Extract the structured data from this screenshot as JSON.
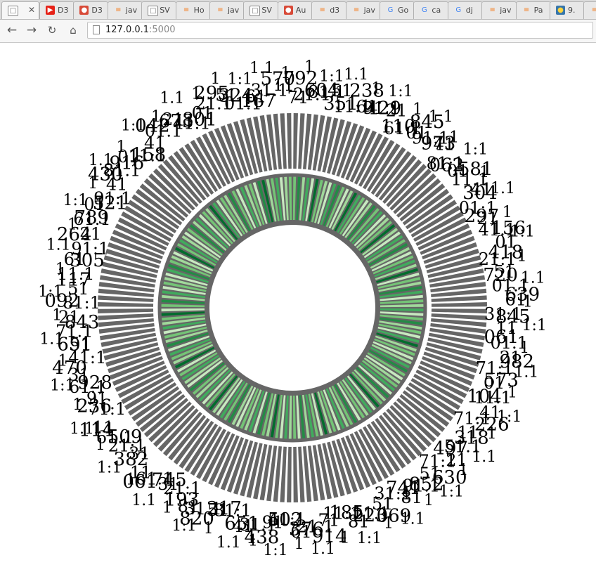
{
  "browser": {
    "tabs": [
      {
        "title": "",
        "icon": "page-icon",
        "active": true
      },
      {
        "title": "D3",
        "icon": "youtube-icon"
      },
      {
        "title": "D3",
        "icon": "chrome-app-icon"
      },
      {
        "title": "jav",
        "icon": "stackoverflow-icon"
      },
      {
        "title": "SV",
        "icon": "page-icon"
      },
      {
        "title": "Ho",
        "icon": "stackoverflow-icon"
      },
      {
        "title": "jav",
        "icon": "stackoverflow-icon"
      },
      {
        "title": "SV",
        "icon": "page-icon"
      },
      {
        "title": "Au",
        "icon": "chrome-app-icon"
      },
      {
        "title": "d3",
        "icon": "stackoverflow-icon"
      },
      {
        "title": "jav",
        "icon": "stackoverflow-icon"
      },
      {
        "title": "Go",
        "icon": "google-icon"
      },
      {
        "title": "ca",
        "icon": "google-icon"
      },
      {
        "title": "dj",
        "icon": "google-icon"
      },
      {
        "title": "jav",
        "icon": "stackoverflow-icon"
      },
      {
        "title": "Pa",
        "icon": "stackoverflow-icon"
      },
      {
        "title": "9.",
        "icon": "python-icon"
      },
      {
        "title": "",
        "icon": "stackoverflow-icon"
      }
    ],
    "url_host": "127.0.0.1",
    "url_port": ":5000",
    "nav_icons": [
      "back-arrow-icon",
      "forward-arrow-icon",
      "reload-icon",
      "home-icon"
    ]
  },
  "colors": {
    "bar_gray": "#666666",
    "heat_palette": [
      "#c7e9c0",
      "#a1d99b",
      "#74c476",
      "#41ab5d",
      "#238b45",
      "#006d2c"
    ],
    "label": "#000000"
  },
  "viz": {
    "heat_levels": [
      2,
      4,
      1,
      3,
      0,
      5,
      2,
      1,
      0,
      3,
      4,
      2,
      0,
      1,
      5,
      3,
      2,
      0,
      1,
      4,
      2,
      3,
      0,
      1,
      2,
      5,
      1,
      0,
      3,
      2,
      4,
      1,
      0,
      2,
      3,
      1,
      5,
      0,
      2,
      1,
      4,
      3,
      0,
      2,
      1,
      3,
      0,
      2,
      4,
      1,
      2,
      0,
      3,
      5,
      1,
      2,
      0,
      1,
      3,
      4,
      2,
      0,
      1,
      2,
      3,
      0,
      4,
      1,
      2,
      5,
      0,
      3,
      1,
      2,
      0,
      4,
      2,
      1,
      3,
      0,
      2,
      1,
      5,
      0,
      2,
      3,
      1,
      4,
      0,
      2,
      1,
      3,
      0,
      2,
      5,
      1,
      2,
      4,
      0,
      3,
      1,
      2,
      0,
      1,
      4,
      2,
      3,
      0,
      1,
      5,
      2,
      0,
      3,
      1,
      2,
      4,
      0,
      1,
      3,
      2,
      0,
      5,
      1,
      2,
      3,
      0,
      4,
      1,
      2,
      0,
      3,
      1,
      2,
      5,
      0,
      2,
      4,
      1,
      3,
      0,
      2,
      1,
      0,
      3,
      4,
      2,
      1,
      0,
      5,
      2,
      3,
      1,
      0,
      2,
      4,
      1,
      3,
      0,
      2,
      1,
      5,
      3,
      0,
      2,
      1,
      4,
      2,
      0,
      3,
      1,
      2,
      0,
      4,
      5,
      1,
      2,
      3,
      0,
      1,
      2
    ],
    "labels_outer": [
      "1",
      "1:1",
      "1.1",
      "1",
      "1:1",
      "1",
      "1.1",
      "1",
      "1:1",
      "1",
      "1.1",
      "1",
      "1:1",
      "1",
      "1.1",
      "1",
      "1:1",
      "1",
      "1.1",
      "1",
      "1:1",
      "1",
      "1.1",
      "1",
      "1:1",
      "1",
      "1.1",
      "1",
      "1:1",
      "1",
      "1.1",
      "1",
      "1:1",
      "1",
      "1.1",
      "1",
      "1:1",
      "1",
      "1.1",
      "1",
      "1:1",
      "1",
      "1.1",
      "1",
      "1:1",
      "1",
      "1.1",
      "1",
      "1:1",
      "1",
      "1.1",
      "1",
      "1:1",
      "1",
      "1.1",
      "1",
      "1:1",
      "1",
      "1.1",
      "1"
    ],
    "labels_inner": [
      "7",
      "6",
      "3",
      "2",
      "4",
      "1",
      "8",
      "9",
      "0",
      "5",
      "3",
      "2",
      "1",
      "4",
      "7",
      "6",
      "8",
      "0",
      "9",
      "5",
      "1",
      "2",
      "3",
      "4",
      "6",
      "8",
      "7",
      "0",
      "2",
      "1",
      "9",
      "3",
      "5",
      "4",
      "6",
      "2",
      "8",
      "1",
      "7",
      "0",
      "3",
      "5",
      "1",
      "2",
      "9",
      "4",
      "6",
      "8",
      "0",
      "1",
      "3",
      "2",
      "7",
      "5",
      "4",
      "9",
      "1",
      "0",
      "6",
      "8",
      "2",
      "3",
      "1",
      "5",
      "4",
      "7",
      "0",
      "9",
      "2",
      "6"
    ]
  }
}
